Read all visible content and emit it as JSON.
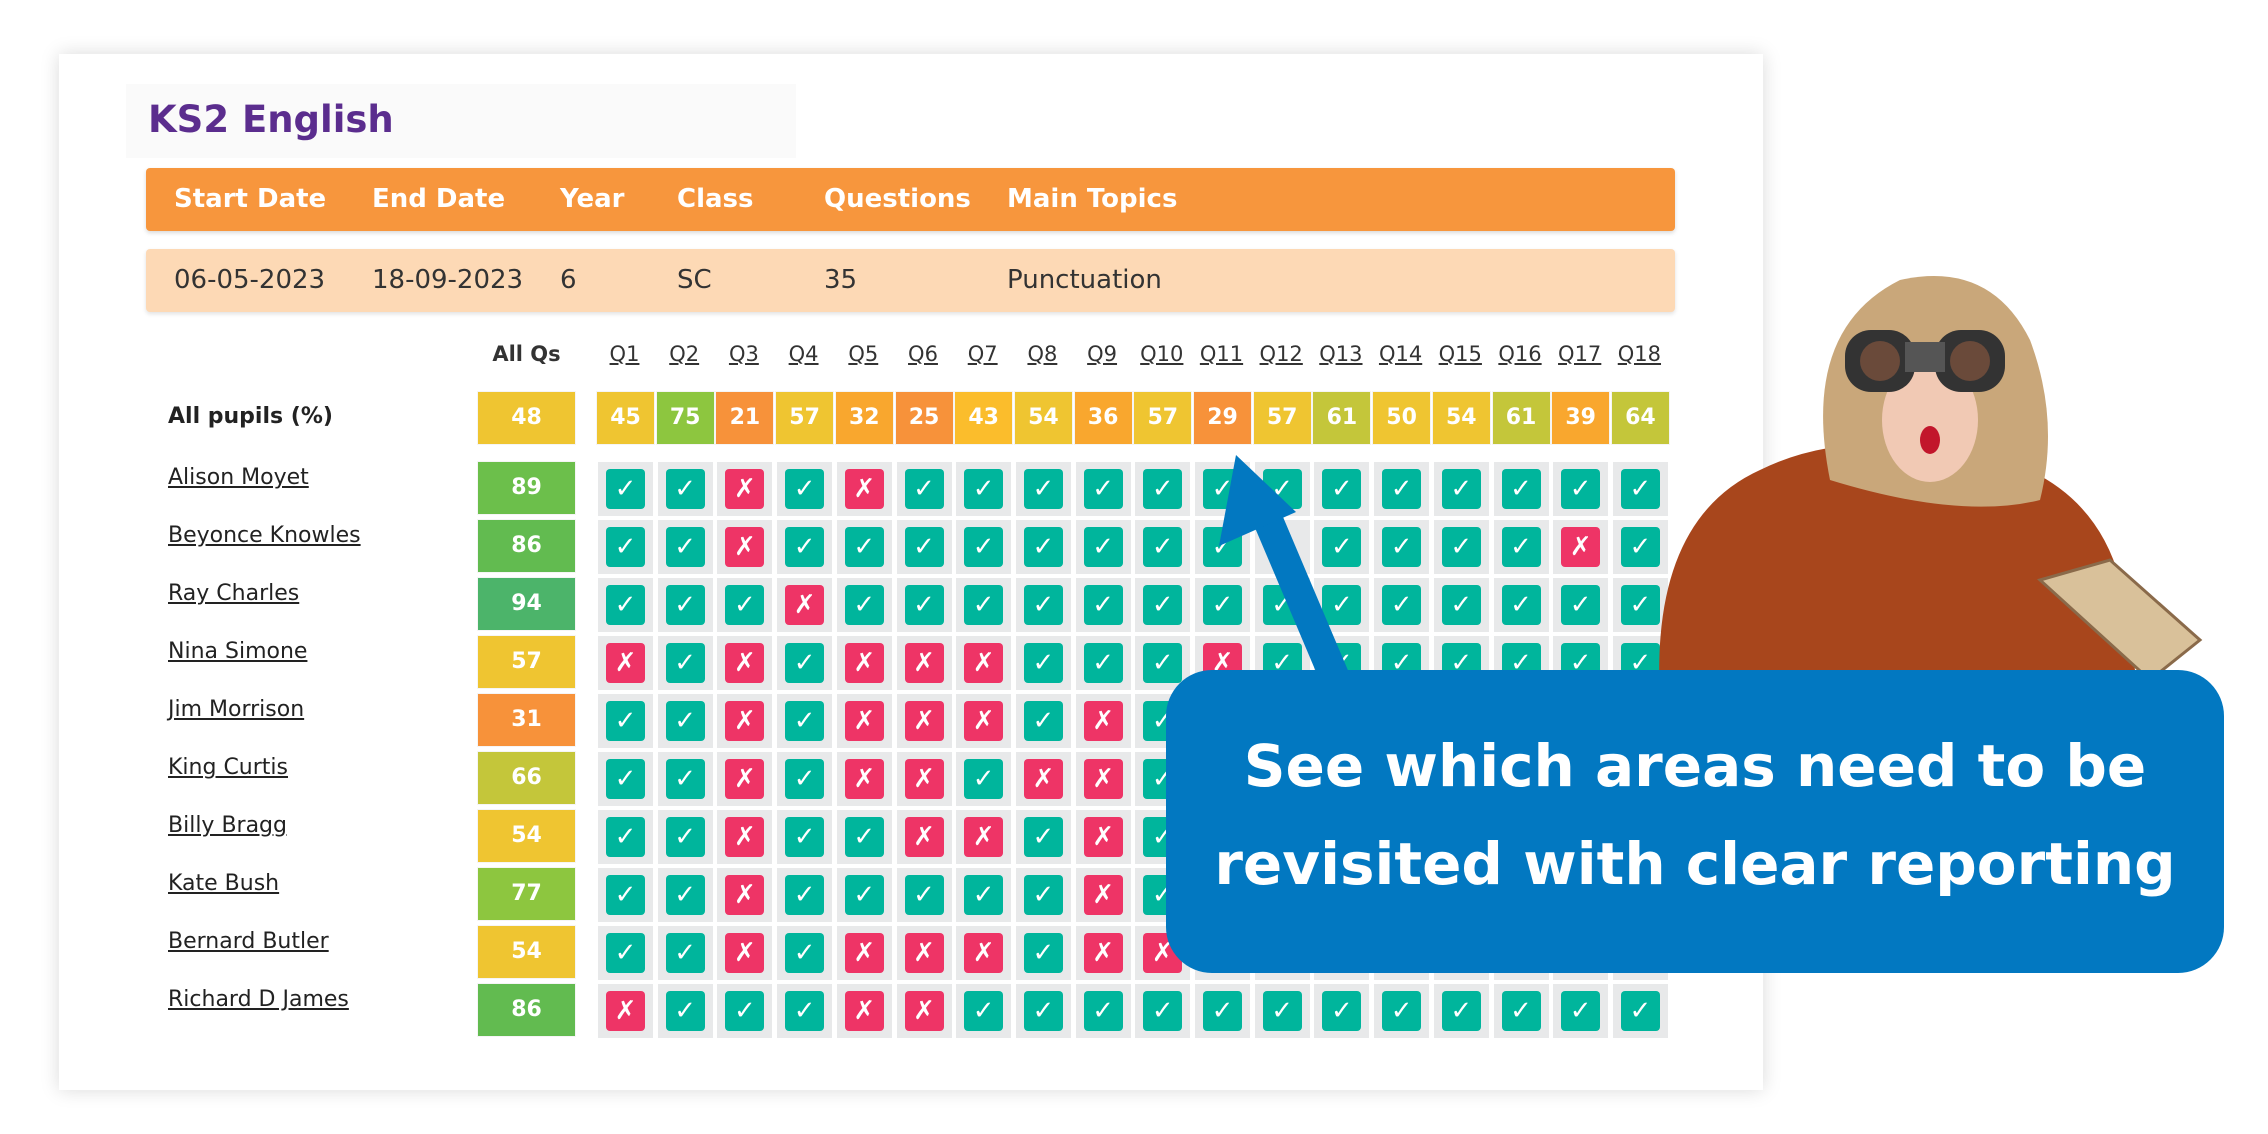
{
  "title": "KS2 English",
  "header": {
    "columns": [
      "Start Date",
      "End Date",
      "Year",
      "Class",
      "Questions",
      "Main Topics"
    ],
    "values": [
      "06-05-2023",
      "18-09-2023",
      "6",
      "SC",
      "35",
      "Punctuation"
    ]
  },
  "grid": {
    "all_qs_label": "All Qs",
    "questions": [
      "Q1",
      "Q2",
      "Q3",
      "Q4",
      "Q5",
      "Q6",
      "Q7",
      "Q8",
      "Q9",
      "Q10",
      "Q11",
      "Q12",
      "Q13",
      "Q14",
      "Q15",
      "Q16",
      "Q17",
      "Q18"
    ],
    "summary": {
      "label": "All pupils (%)",
      "all": 48,
      "all_color": "#efc531",
      "values": [
        45,
        75,
        21,
        57,
        32,
        25,
        43,
        54,
        36,
        57,
        29,
        57,
        61,
        50,
        54,
        61,
        39,
        64
      ],
      "colors": [
        "#efc531",
        "#8dc63f",
        "#f7923a",
        "#efc531",
        "#f9a72e",
        "#f7923a",
        "#fbbd2c",
        "#efc531",
        "#f9a72e",
        "#efc531",
        "#f7923a",
        "#efc531",
        "#c4c63a",
        "#efc531",
        "#efc531",
        "#c4c63a",
        "#f9a72e",
        "#c4c63a"
      ]
    },
    "pupils": [
      {
        "name": "Alison Moyet",
        "score": 89,
        "color": "#6cbf4b",
        "answers": [
          1,
          1,
          0,
          1,
          0,
          1,
          1,
          1,
          1,
          1,
          1,
          1,
          1,
          1,
          1,
          1,
          1,
          1
        ]
      },
      {
        "name": "Beyonce Knowles",
        "score": 86,
        "color": "#62bb50",
        "answers": [
          1,
          1,
          0,
          1,
          1,
          1,
          1,
          1,
          1,
          1,
          1,
          null,
          1,
          1,
          1,
          1,
          0,
          1
        ]
      },
      {
        "name": "Ray Charles",
        "score": 94,
        "color": "#4cb46a",
        "answers": [
          1,
          1,
          1,
          0,
          1,
          1,
          1,
          1,
          1,
          1,
          1,
          1,
          1,
          1,
          1,
          1,
          1,
          1
        ]
      },
      {
        "name": "Nina Simone",
        "score": 57,
        "color": "#efc531",
        "answers": [
          0,
          1,
          0,
          1,
          0,
          0,
          0,
          1,
          1,
          1,
          0,
          1,
          1,
          1,
          1,
          1,
          1,
          1
        ]
      },
      {
        "name": "Jim Morrison",
        "score": 31,
        "color": "#f7923a",
        "answers": [
          1,
          1,
          0,
          1,
          0,
          0,
          0,
          1,
          0,
          1,
          null,
          null,
          null,
          null,
          null,
          null,
          null,
          null
        ]
      },
      {
        "name": "King Curtis",
        "score": 66,
        "color": "#c4c63a",
        "answers": [
          1,
          1,
          0,
          1,
          0,
          0,
          1,
          0,
          0,
          1,
          null,
          null,
          null,
          null,
          null,
          null,
          null,
          null
        ]
      },
      {
        "name": "Billy Bragg",
        "score": 54,
        "color": "#efc531",
        "answers": [
          1,
          1,
          0,
          1,
          1,
          0,
          0,
          1,
          0,
          1,
          null,
          null,
          null,
          null,
          null,
          null,
          null,
          null
        ]
      },
      {
        "name": "Kate Bush",
        "score": 77,
        "color": "#8dc63f",
        "answers": [
          1,
          1,
          0,
          1,
          1,
          1,
          1,
          1,
          0,
          1,
          null,
          null,
          null,
          null,
          null,
          null,
          null,
          null
        ]
      },
      {
        "name": "Bernard Butler",
        "score": 54,
        "color": "#efc531",
        "answers": [
          1,
          1,
          0,
          1,
          0,
          0,
          0,
          1,
          0,
          0,
          null,
          null,
          null,
          null,
          null,
          null,
          null,
          null
        ]
      },
      {
        "name": "Richard D James",
        "score": 86,
        "color": "#62bb50",
        "answers": [
          0,
          1,
          1,
          1,
          0,
          0,
          1,
          1,
          1,
          1,
          1,
          1,
          1,
          1,
          1,
          1,
          1,
          1
        ]
      }
    ],
    "correct_color": "#00b59c",
    "wrong_color": "#ee3466",
    "correct_icon": "check-icon",
    "wrong_icon": "cross-icon"
  },
  "callout": {
    "line1": "See which areas need to be",
    "line2": "revisited with clear reporting",
    "color": "#0278c1"
  }
}
